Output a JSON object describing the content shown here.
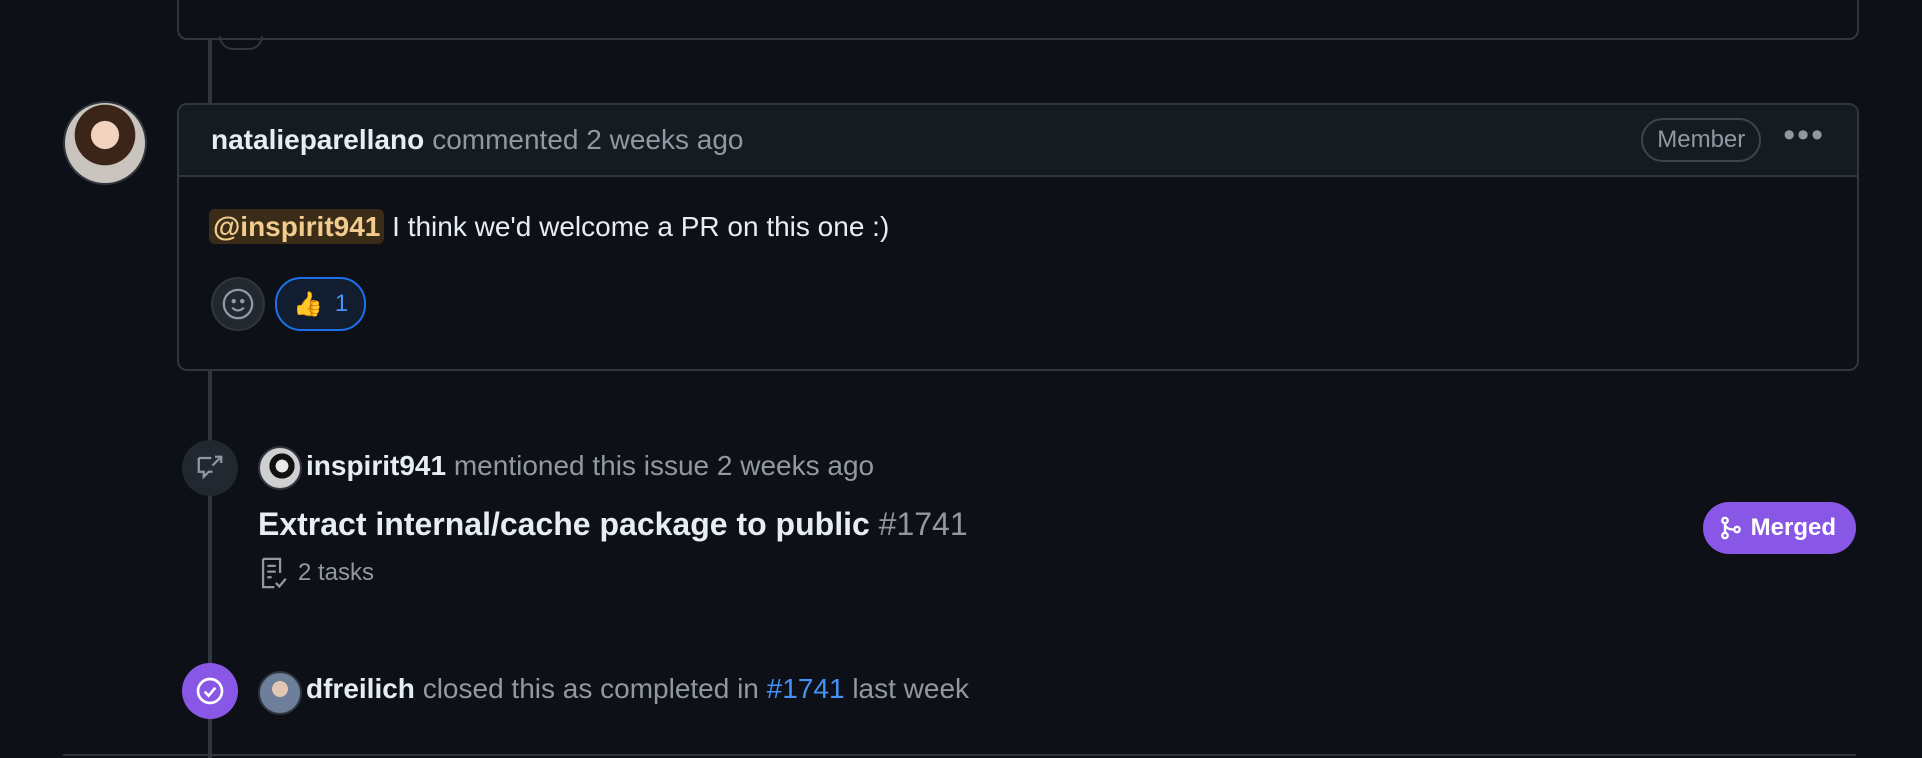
{
  "previous": {},
  "comment": {
    "author": "natalieparellano",
    "meta": "commented 2 weeks ago",
    "badge": "Member",
    "menu_glyph": "•••",
    "mention": "@inspirit941",
    "body": "I think we'd welcome a PR on this one :)",
    "reactions": [
      {
        "emoji": "👍",
        "count": "1"
      }
    ]
  },
  "mention_event": {
    "who": "inspirit941",
    "action": "mentioned this issue",
    "when": "2 weeks ago",
    "pr_title": "Extract internal/cache package to public",
    "pr_number": "#1741",
    "tasks": "2 tasks",
    "status": "Merged"
  },
  "closed_event": {
    "who": "dfreilich",
    "action": "closed this as completed in",
    "ref": "#1741",
    "when": "last week"
  },
  "colors": {
    "background": "#0d1117",
    "border": "#30363d",
    "muted_text": "#9198a1",
    "merged_purple": "#8957e5",
    "link_blue": "#4493f8"
  },
  "icons": [
    "smiley-icon",
    "cross-reference-icon",
    "task-list-icon",
    "git-merge-icon",
    "check-circle-icon",
    "kebab-menu-icon"
  ]
}
